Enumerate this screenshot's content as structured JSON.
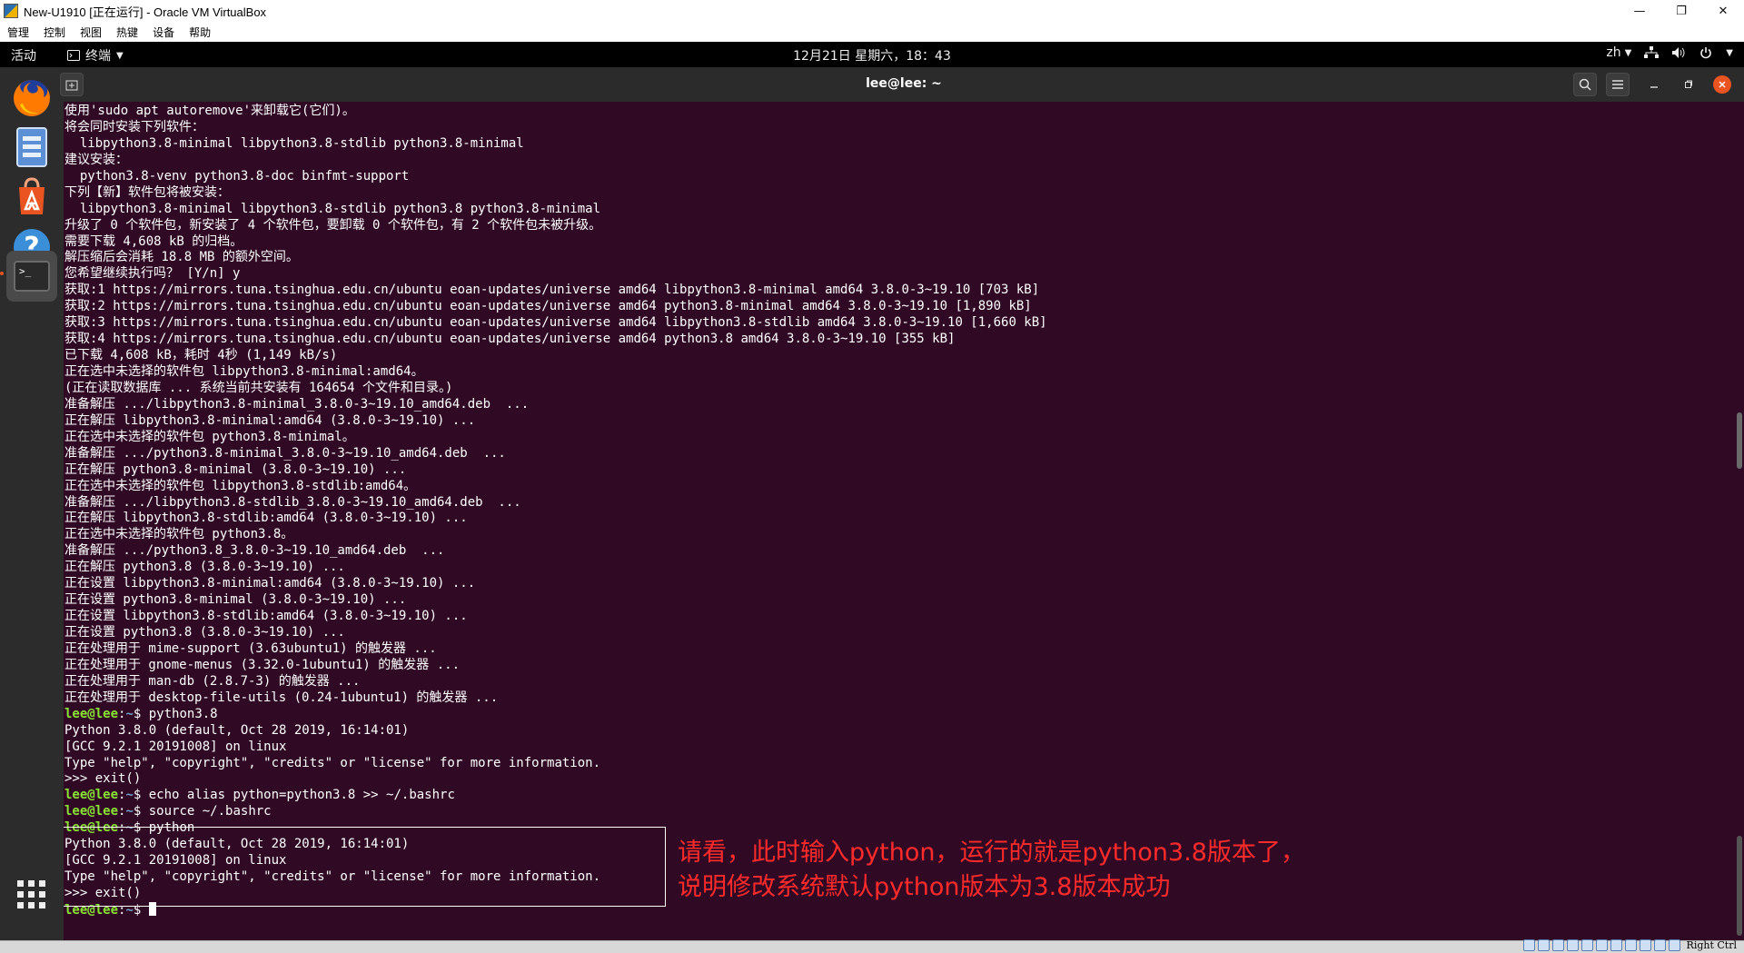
{
  "vbox": {
    "window_title": "New-U1910 [正在运行] - Oracle VM VirtualBox",
    "menu": [
      "管理",
      "控制",
      "视图",
      "热键",
      "设备",
      "帮助"
    ],
    "controls": {
      "minimize": "—",
      "restore": "❐",
      "close": "✕"
    },
    "status_host_key": "Right Ctrl"
  },
  "gnome": {
    "activities": "活动",
    "app_menu_label": "终端",
    "clock": "12月21日 星期六，18：43",
    "input_method": "zh"
  },
  "dock": {
    "items": [
      {
        "name": "firefox-icon"
      },
      {
        "name": "files-icon"
      },
      {
        "name": "software-center-icon"
      },
      {
        "name": "help-icon",
        "glyph": "?"
      },
      {
        "name": "terminal-icon",
        "glyph": ">_"
      },
      {
        "name": "show-apps-icon"
      }
    ]
  },
  "terminal": {
    "title": "lee@lee: ~",
    "prompt": {
      "user": "lee@lee",
      "sep": ":",
      "path": "~",
      "sym": "$ "
    },
    "lines": [
      "使用'sudo apt autoremove'来卸载它(它们)。",
      "将会同时安装下列软件：",
      "  libpython3.8-minimal libpython3.8-stdlib python3.8-minimal",
      "建议安装：",
      "  python3.8-venv python3.8-doc binfmt-support",
      "下列【新】软件包将被安装：",
      "  libpython3.8-minimal libpython3.8-stdlib python3.8 python3.8-minimal",
      "升级了 0 个软件包，新安装了 4 个软件包，要卸载 0 个软件包，有 2 个软件包未被升级。",
      "需要下载 4,608 kB 的归档。",
      "解压缩后会消耗 18.8 MB 的额外空间。",
      "您希望继续执行吗？ [Y/n] y",
      "获取:1 https://mirrors.tuna.tsinghua.edu.cn/ubuntu eoan-updates/universe amd64 libpython3.8-minimal amd64 3.8.0-3~19.10 [703 kB]",
      "获取:2 https://mirrors.tuna.tsinghua.edu.cn/ubuntu eoan-updates/universe amd64 python3.8-minimal amd64 3.8.0-3~19.10 [1,890 kB]",
      "获取:3 https://mirrors.tuna.tsinghua.edu.cn/ubuntu eoan-updates/universe amd64 libpython3.8-stdlib amd64 3.8.0-3~19.10 [1,660 kB]",
      "获取:4 https://mirrors.tuna.tsinghua.edu.cn/ubuntu eoan-updates/universe amd64 python3.8 amd64 3.8.0-3~19.10 [355 kB]",
      "已下载 4,608 kB，耗时 4秒 (1,149 kB/s)",
      "正在选中未选择的软件包 libpython3.8-minimal:amd64。",
      "(正在读取数据库 ... 系统当前共安装有 164654 个文件和目录。)",
      "准备解压 .../libpython3.8-minimal_3.8.0-3~19.10_amd64.deb  ...",
      "正在解压 libpython3.8-minimal:amd64 (3.8.0-3~19.10) ...",
      "正在选中未选择的软件包 python3.8-minimal。",
      "准备解压 .../python3.8-minimal_3.8.0-3~19.10_amd64.deb  ...",
      "正在解压 python3.8-minimal (3.8.0-3~19.10) ...",
      "正在选中未选择的软件包 libpython3.8-stdlib:amd64。",
      "准备解压 .../libpython3.8-stdlib_3.8.0-3~19.10_amd64.deb  ...",
      "正在解压 libpython3.8-stdlib:amd64 (3.8.0-3~19.10) ...",
      "正在选中未选择的软件包 python3.8。",
      "准备解压 .../python3.8_3.8.0-3~19.10_amd64.deb  ...",
      "正在解压 python3.8 (3.8.0-3~19.10) ...",
      "正在设置 libpython3.8-minimal:amd64 (3.8.0-3~19.10) ...",
      "正在设置 python3.8-minimal (3.8.0-3~19.10) ...",
      "正在设置 libpython3.8-stdlib:amd64 (3.8.0-3~19.10) ...",
      "正在设置 python3.8 (3.8.0-3~19.10) ...",
      "正在处理用于 mime-support (3.63ubuntu1) 的触发器 ...",
      "正在处理用于 gnome-menus (3.32.0-1ubuntu1) 的触发器 ...",
      "正在处理用于 man-db (2.8.7-3) 的触发器 ...",
      "正在处理用于 desktop-file-utils (0.24-1ubuntu1) 的触发器 ..."
    ],
    "session": [
      {
        "prompt": true,
        "cmd": "python3.8"
      },
      {
        "text": "Python 3.8.0 (default, Oct 28 2019, 16:14:01)"
      },
      {
        "text": "[GCC 9.2.1 20191008] on linux"
      },
      {
        "text": "Type \"help\", \"copyright\", \"credits\" or \"license\" for more information."
      },
      {
        "text": ">>> exit()"
      },
      {
        "prompt": true,
        "cmd": "echo alias python=python3.8 >> ~/.bashrc"
      },
      {
        "prompt": true,
        "cmd": "source ~/.bashrc"
      },
      {
        "prompt": true,
        "cmd": "python"
      },
      {
        "text": "Python 3.8.0 (default, Oct 28 2019, 16:14:01)"
      },
      {
        "text": "[GCC 9.2.1 20191008] on linux"
      },
      {
        "text": "Type \"help\", \"copyright\", \"credits\" or \"license\" for more information."
      },
      {
        "text": ">>> exit()"
      },
      {
        "prompt": true,
        "cmd": "",
        "cursor": true
      }
    ],
    "annotation": [
      "请看，此时输入python，运行的就是python3.8版本了，",
      "说明修改系统默认python版本为3.8版本成功"
    ]
  },
  "colors": {
    "terminal_bg": "#300a24",
    "prompt_user": "#8ae234",
    "prompt_path": "#729fcf",
    "annotation": "#ff2a2a",
    "accent": "#e95420"
  }
}
